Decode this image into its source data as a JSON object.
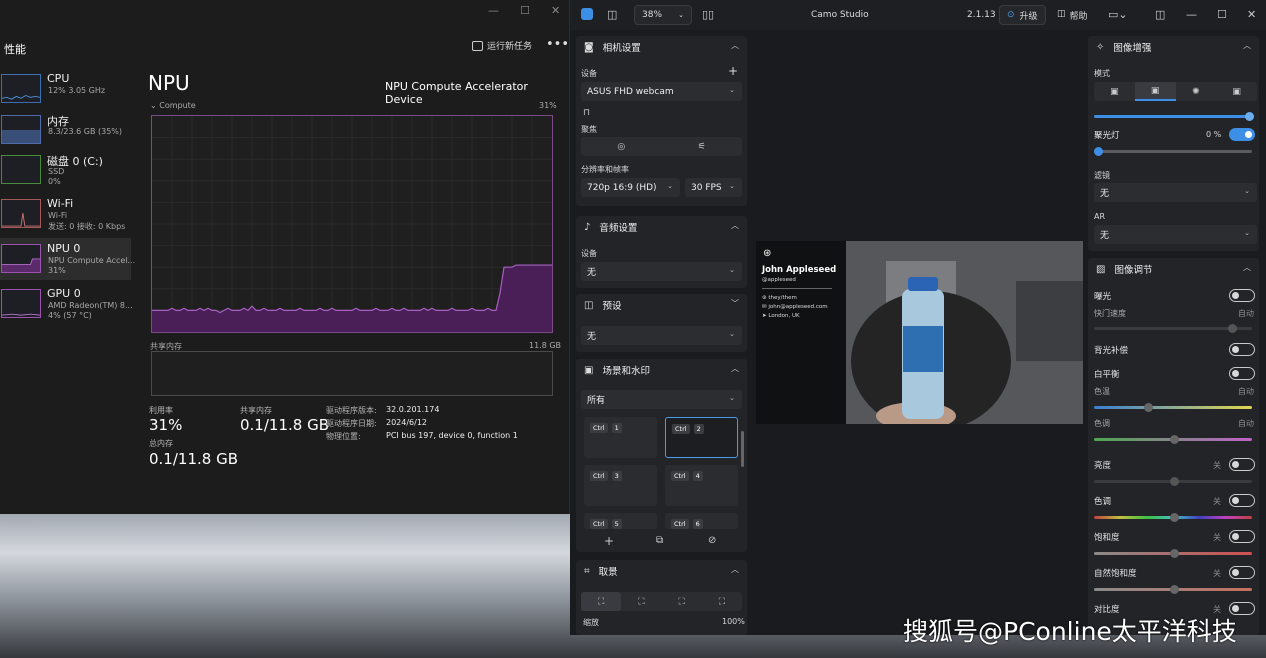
{
  "desktop": {
    "year": "2024",
    "watermark": "搜狐号@PConline太平洋科技"
  },
  "taskmgr": {
    "window_controls": {
      "minimize": "—",
      "maximize": "☐",
      "close": "✕"
    },
    "section_title": "性能",
    "run_task_label": "运行新任务",
    "more": "•••",
    "resources": [
      {
        "name": "CPU",
        "sub1": "12% 3.05 GHz",
        "sub2": ""
      },
      {
        "name": "内存",
        "sub1": "8.3/23.6 GB (35%)",
        "sub2": ""
      },
      {
        "name": "磁盘 0 (C:)",
        "sub1": "SSD",
        "sub2": "0%"
      },
      {
        "name": "Wi-Fi",
        "sub1": "Wi-Fi",
        "sub2": "发送: 0 接收: 0 Kbps"
      },
      {
        "name": "NPU 0",
        "sub1": "NPU Compute Accel...",
        "sub2": "31%"
      },
      {
        "name": "GPU 0",
        "sub1": "AMD Radeon(TM) 8...",
        "sub2": "4% (57 °C)"
      }
    ],
    "npu": {
      "title": "NPU",
      "device": "NPU Compute Accelerator Device",
      "compute_label": "Compute",
      "compute_pct": "31%",
      "shared_label": "共享内存",
      "shared_max": "11.8 GB",
      "usage_points": [
        10,
        10,
        10,
        10,
        10,
        11,
        10,
        10,
        11,
        10,
        10,
        10,
        11,
        10,
        11,
        10,
        10,
        9,
        10,
        11,
        10,
        10,
        10,
        11,
        10,
        12,
        10,
        10,
        11,
        10,
        10,
        10,
        11,
        10,
        10,
        10,
        10,
        11,
        10,
        10,
        10,
        10,
        11,
        10,
        10,
        11,
        10,
        10,
        10,
        10,
        10,
        11,
        10,
        10,
        10,
        10,
        11,
        10,
        10,
        10,
        11,
        10,
        10,
        11,
        10,
        10,
        10,
        10,
        11,
        10,
        11,
        10,
        10,
        10,
        10,
        11,
        10,
        10,
        10,
        10,
        11,
        10,
        10,
        10,
        11,
        10,
        10,
        18,
        30,
        30,
        30,
        31,
        31,
        31,
        31,
        31,
        31,
        31,
        31,
        31,
        31
      ]
    },
    "stats": {
      "util_label": "利用率",
      "util_value": "31%",
      "shared_label": "共享内存",
      "shared_value": "0.1/11.8 GB",
      "total_label": "总内存",
      "total_value": "0.1/11.8 GB"
    },
    "driver": {
      "version_label": "驱动程序版本:",
      "version": "32.0.201.174",
      "date_label": "驱动程序日期:",
      "date": "2024/6/12",
      "loc_label": "物理位置:",
      "loc": "PCI bus 197, device 0, function 1"
    }
  },
  "camo": {
    "title": "Camo Studio",
    "zoom": "38%",
    "version": "2.1.13",
    "upgrade": "升级",
    "help": "帮助",
    "window_controls": {
      "minimize": "—",
      "maximize": "☐",
      "close": "✕"
    },
    "camera": {
      "header": "相机设置",
      "device_label": "设备",
      "device_value": "ASUS FHD webcam",
      "focus_label": "聚焦",
      "res_label": "分辨率和帧率",
      "res_value": "720p 16:9 (HD)",
      "fps_value": "30 FPS"
    },
    "audio": {
      "header": "音频设置",
      "device_label": "设备",
      "device_value": "无"
    },
    "presets": {
      "header": "预设",
      "value": "无"
    },
    "scenes": {
      "header": "场景和水印",
      "filter": "所有",
      "tiles": [
        {
          "k1": "Ctrl",
          "k2": "1"
        },
        {
          "k1": "Ctrl",
          "k2": "2"
        },
        {
          "k1": "Ctrl",
          "k2": "3"
        },
        {
          "k1": "Ctrl",
          "k2": "4"
        },
        {
          "k1": "Ctrl",
          "k2": "5"
        },
        {
          "k1": "Ctrl",
          "k2": "6"
        }
      ]
    },
    "framing": {
      "header": "取景",
      "zoom_label": "缩放",
      "zoom_value": "100%"
    },
    "overlay": {
      "name": "John Appleseed",
      "handle": "@appleseed",
      "pronoun": "they/them",
      "email": "john@appleseed.com",
      "location": "London, UK"
    },
    "enhance": {
      "header": "图像增强",
      "mode_label": "模式",
      "spotlight_label": "聚光灯",
      "spotlight_value": "0 %",
      "filter_label": "滤镜",
      "filter_value": "无",
      "ar_label": "AR",
      "ar_value": "无"
    },
    "adjust": {
      "header": "图像调节",
      "exposure": "曝光",
      "speed": "快门速度",
      "speed_state": "自动",
      "backlight": "背光补偿",
      "wb": "白平衡",
      "temp": "色温",
      "temp_state": "自动",
      "tint": "色调",
      "tint_state": "自动",
      "brightness": "亮度",
      "brightness_state": "关",
      "hue": "色调",
      "hue_state": "关",
      "saturation": "饱和度",
      "saturation_state": "关",
      "vibrance": "自然饱和度",
      "vibrance_state": "关",
      "contrast": "对比度",
      "contrast_state": "关"
    },
    "accent": "#3d8fe6"
  }
}
